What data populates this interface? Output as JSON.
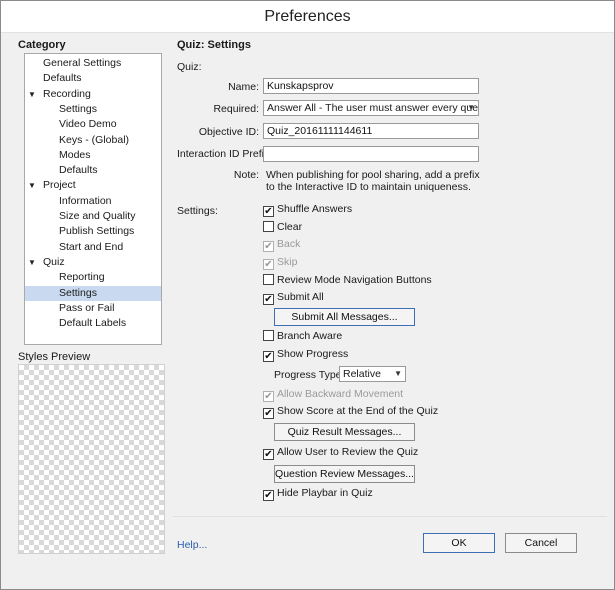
{
  "window": {
    "title": "Preferences"
  },
  "category": {
    "title": "Category",
    "items": [
      {
        "label": "General Settings",
        "level": 1,
        "expandable": false,
        "selected": false
      },
      {
        "label": "Defaults",
        "level": 1,
        "expandable": false,
        "selected": false
      },
      {
        "label": "Recording",
        "level": 1,
        "expandable": true,
        "selected": false
      },
      {
        "label": "Settings",
        "level": 2,
        "expandable": false,
        "selected": false
      },
      {
        "label": "Video Demo",
        "level": 2,
        "expandable": false,
        "selected": false
      },
      {
        "label": "Keys - (Global)",
        "level": 2,
        "expandable": false,
        "selected": false
      },
      {
        "label": "Modes",
        "level": 2,
        "expandable": false,
        "selected": false
      },
      {
        "label": "Defaults",
        "level": 2,
        "expandable": false,
        "selected": false
      },
      {
        "label": "Project",
        "level": 1,
        "expandable": true,
        "selected": false
      },
      {
        "label": "Information",
        "level": 2,
        "expandable": false,
        "selected": false
      },
      {
        "label": "Size and Quality",
        "level": 2,
        "expandable": false,
        "selected": false
      },
      {
        "label": "Publish Settings",
        "level": 2,
        "expandable": false,
        "selected": false
      },
      {
        "label": "Start and End",
        "level": 2,
        "expandable": false,
        "selected": false
      },
      {
        "label": "Quiz",
        "level": 1,
        "expandable": true,
        "selected": false
      },
      {
        "label": "Reporting",
        "level": 2,
        "expandable": false,
        "selected": false
      },
      {
        "label": "Settings",
        "level": 2,
        "expandable": false,
        "selected": true
      },
      {
        "label": "Pass or Fail",
        "level": 2,
        "expandable": false,
        "selected": false
      },
      {
        "label": "Default Labels",
        "level": 2,
        "expandable": false,
        "selected": false
      }
    ],
    "expand_glyph": "▼"
  },
  "styles_preview": {
    "title": "Styles Preview"
  },
  "panel": {
    "heading": "Quiz: Settings",
    "quiz_label": "Quiz:",
    "name": {
      "label": "Name:",
      "value": "Kunskapsprov"
    },
    "required": {
      "label": "Required:",
      "value": "Answer All - The user must answer every que..."
    },
    "objective_id": {
      "label": "Objective ID:",
      "value": "Quiz_20161111144611"
    },
    "interaction_prefix": {
      "label": "Interaction ID Prefix:",
      "value": ""
    },
    "note": {
      "label": "Note:",
      "line1": "When publishing for pool sharing, add a prefix",
      "line2": "to the Interactive ID to maintain uniqueness."
    },
    "settings_label": "Settings:",
    "options": {
      "shuffle_answers": {
        "label": "Shuffle Answers",
        "checked": true,
        "disabled": false
      },
      "clear": {
        "label": "Clear",
        "checked": false,
        "disabled": false
      },
      "back": {
        "label": "Back",
        "checked": true,
        "disabled": true
      },
      "skip": {
        "label": "Skip",
        "checked": true,
        "disabled": true
      },
      "review_mode_nav": {
        "label": "Review Mode Navigation Buttons",
        "checked": false,
        "disabled": false
      },
      "submit_all": {
        "label": "Submit All",
        "checked": true,
        "disabled": false
      },
      "branch_aware": {
        "label": "Branch Aware",
        "checked": false,
        "disabled": false
      },
      "show_progress": {
        "label": "Show Progress",
        "checked": true,
        "disabled": false
      },
      "allow_backward": {
        "label": "Allow Backward Movement",
        "checked": true,
        "disabled": true
      },
      "show_score": {
        "label": "Show Score at the End of the Quiz",
        "checked": true,
        "disabled": false
      },
      "allow_review": {
        "label": "Allow User to Review the Quiz",
        "checked": true,
        "disabled": false
      },
      "hide_playbar": {
        "label": "Hide Playbar in Quiz",
        "checked": true,
        "disabled": false
      }
    },
    "progress_type": {
      "label": "Progress Type:",
      "value": "Relative"
    },
    "buttons": {
      "submit_all_messages": "Submit All Messages...",
      "quiz_result_messages": "Quiz Result Messages...",
      "question_review_messages": "Question Review Messages..."
    }
  },
  "footer": {
    "help": "Help...",
    "ok": "OK",
    "cancel": "Cancel"
  },
  "check_glyph": "✔"
}
